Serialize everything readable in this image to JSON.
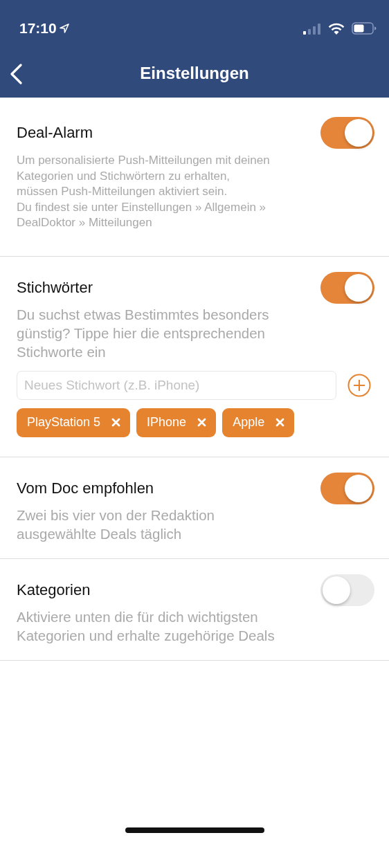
{
  "status_bar": {
    "time": "17:10"
  },
  "nav": {
    "title": "Einstellungen"
  },
  "sections": [
    {
      "kind": "small",
      "title": "Deal-Alarm",
      "on": true,
      "description": "Um personalisierte Push-Mitteilungen mit deinen\nKategorien und Stichwörtern zu erhalten,\nmüssen Push-Mitteilungen aktiviert sein.\nDu findest sie unter Einstellungen » Allgemein »\nDealDoktor » Mitteilungen"
    },
    {
      "kind": "keywords",
      "title": "Stichwörter",
      "on": true,
      "description": "Du suchst etwas Bestimmtes besonders\ngünstig? Tippe hier die entsprechenden\nStichworte ein",
      "placeholder": "Neues Stichwort (z.B. iPhone)",
      "chips": [
        "PlayStation 5",
        "IPhone",
        "Apple"
      ]
    },
    {
      "kind": "large",
      "title": "Vom Doc empfohlen",
      "on": true,
      "description": "Zwei bis vier von der Redaktion\nausgewählte Deals täglich"
    },
    {
      "kind": "large",
      "title": "Kategorien",
      "on": false,
      "description": "Aktiviere unten die für dich wichtigsten\nKategorien und erhalte zugehörige Deals"
    }
  ]
}
